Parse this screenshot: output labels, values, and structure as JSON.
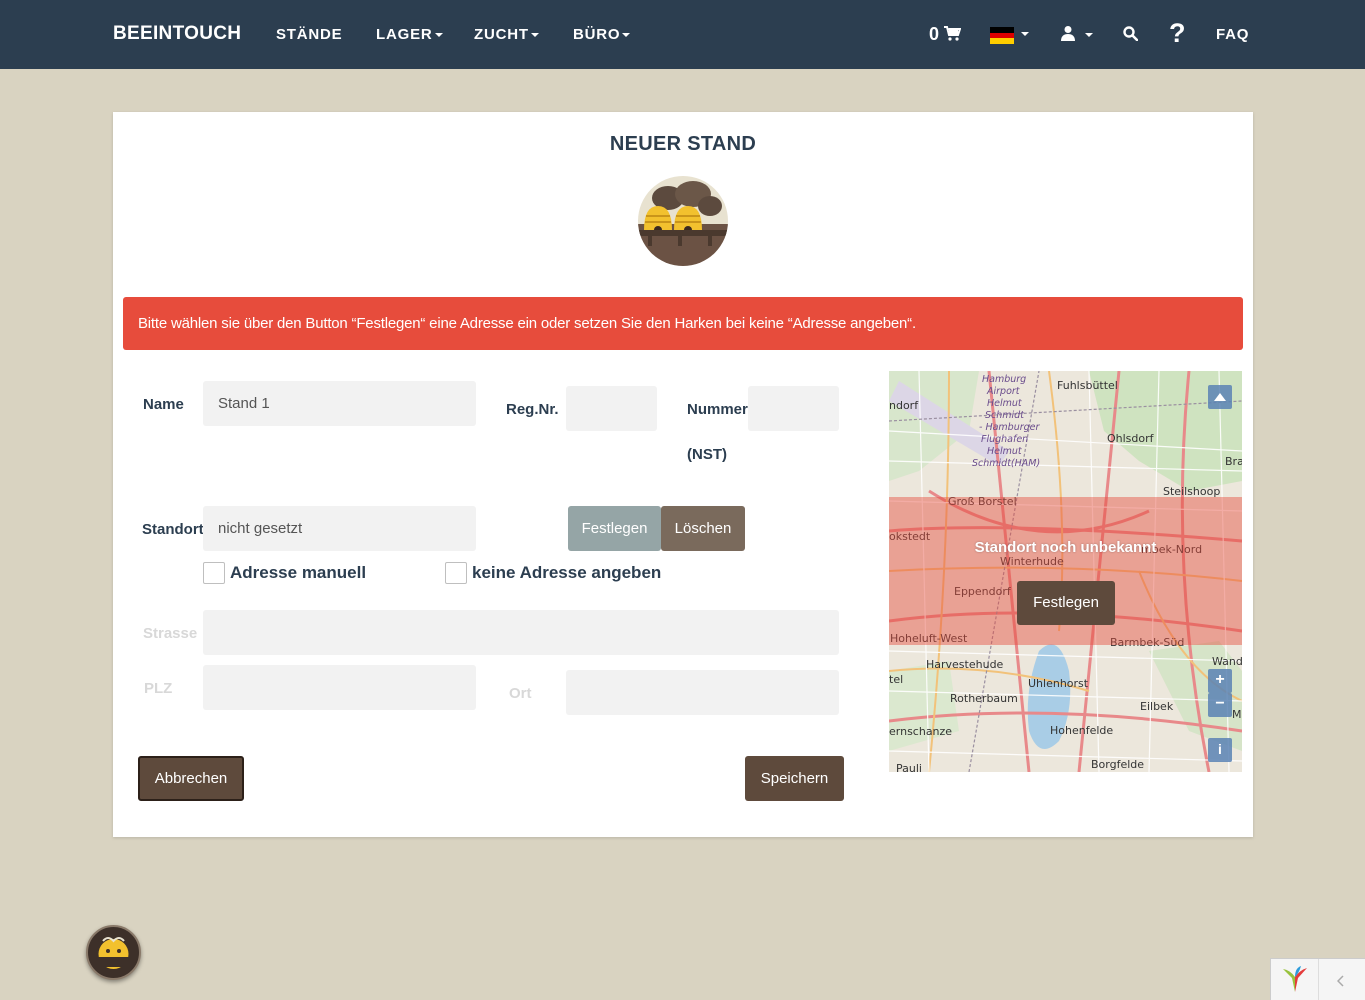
{
  "nav": {
    "brand": "BEEINTOUCH",
    "items": [
      "STÄNDE",
      "LAGER",
      "ZUCHT",
      "BÜRO"
    ],
    "cart_count": "0",
    "faq": "FAQ",
    "help_glyph": "?"
  },
  "panel": {
    "title": "NEUER STAND",
    "alert": "Bitte wählen sie über den Button “Festlegen“ eine Adresse ein oder setzen Sie den Harken bei keine “Adresse angeben“."
  },
  "form": {
    "name_label": "Name",
    "name_value": "Stand 1",
    "regnr_label": "Reg.Nr.",
    "nummer_label": "Nummer",
    "nst_label": "(NST)",
    "standort_label": "Standort",
    "standort_value": "nicht gesetzt",
    "festlegen": "Festlegen",
    "loeschen": "Löschen",
    "adresse_manuell": "Adresse manuell",
    "keine_adresse": "keine Adresse angeben",
    "strasse_label": "Strasse",
    "plz_label": "PLZ",
    "ort_label": "Ort",
    "abbrechen": "Abbrechen",
    "speichern": "Speichern"
  },
  "map": {
    "message": "Standort noch unbekannt",
    "button": "Festlegen",
    "zoom_in": "+",
    "zoom_out": "−",
    "info": "i",
    "labels": [
      "Hamburg",
      "Airport",
      "Helmut",
      "Schmidt",
      "- Hamburger",
      "Flughafen",
      "Helmut",
      "Schmidt(HAM)",
      "Fuhlsbüttel",
      "ndorf",
      "Ohlsdorf",
      "Bra",
      "Steilshoop",
      "Groß Borstel",
      "okstedt",
      "Winterhude",
      "mbek-Nord",
      "Eppendorf",
      "Hoheluft-West",
      "Barmbek-Süd",
      "Harvestehude",
      "Wand",
      "tel",
      "Uhlenhorst",
      "Rotherbaum",
      "Eilbek",
      "M",
      "ernschanze",
      "Hohenfelde",
      "Pauli",
      "Borgfelde"
    ]
  },
  "colors": {
    "navbar": "#2c3e50",
    "alert": "#e74c3c",
    "brown": "#5e4a3c",
    "background": "#d9d3c1"
  }
}
